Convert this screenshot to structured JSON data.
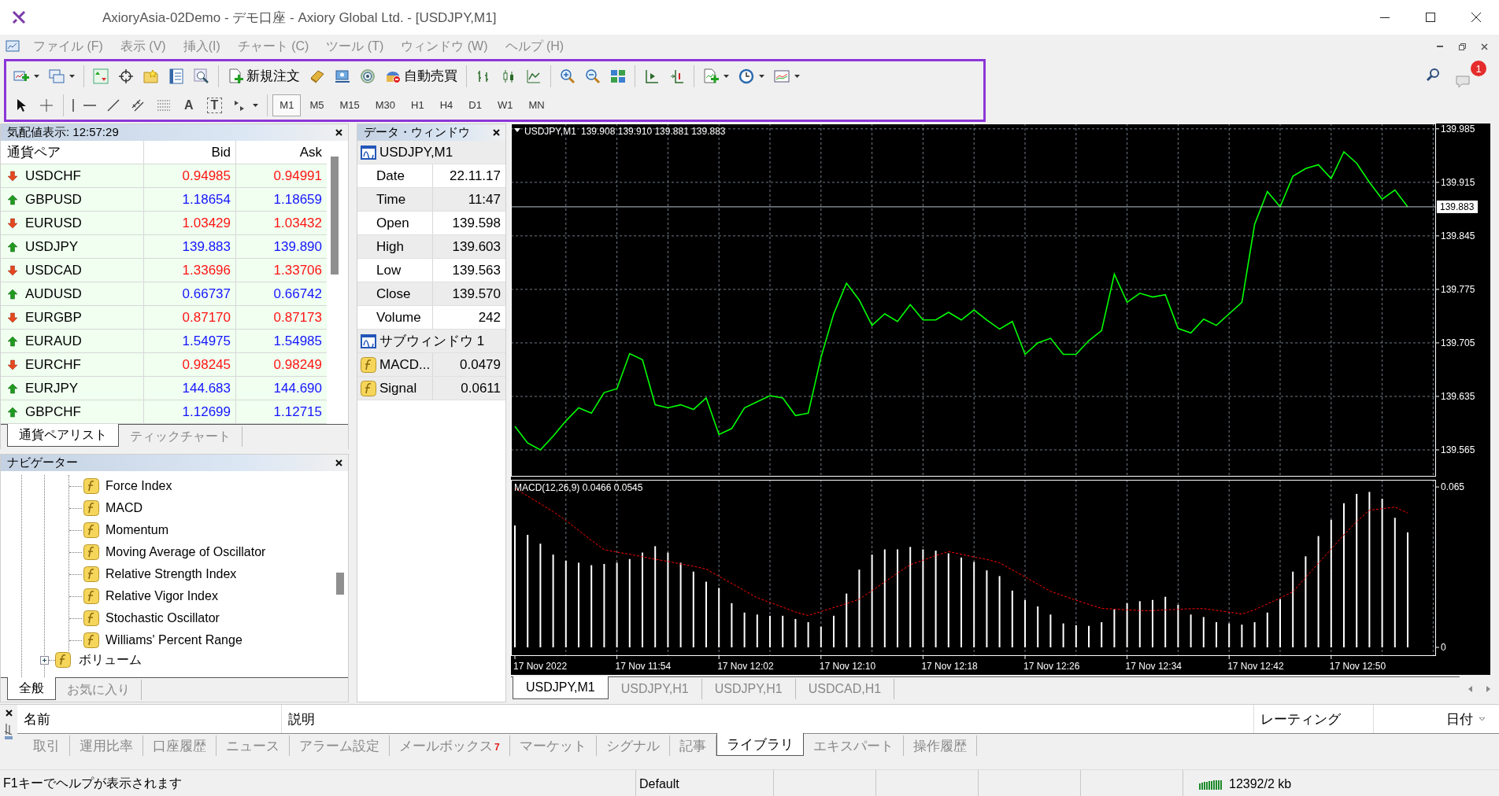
{
  "window": {
    "title": "AxioryAsia-02Demo - デモ口座 - Axiory Global Ltd. - [USDJPY,M1]"
  },
  "menu": [
    "ファイル (F)",
    "表示 (V)",
    "挿入(I)",
    "チャート (C)",
    "ツール (T)",
    "ウィンドウ (W)",
    "ヘルプ (H)"
  ],
  "toolbar": {
    "rows": [
      [
        {
          "kind": "icon",
          "dropdown": true
        },
        {
          "kind": "icon",
          "dropdown": true
        },
        {
          "kind": "separator"
        },
        {
          "kind": "icon",
          "dropdown": false
        },
        {
          "kind": "icon",
          "dropdown": false
        },
        {
          "kind": "icon",
          "dropdown": false
        },
        {
          "kind": "icon",
          "dropdown": false
        },
        {
          "kind": "icon",
          "dropdown": false
        },
        {
          "kind": "separator"
        },
        {
          "kind": "text",
          "label": "新規注文",
          "dropdown": false
        },
        {
          "kind": "icon",
          "dropdown": false
        },
        {
          "kind": "icon",
          "dropdown": false
        },
        {
          "kind": "icon",
          "dropdown": false
        },
        {
          "kind": "text",
          "label": "自動売買",
          "dropdown": false
        },
        {
          "kind": "separator"
        },
        {
          "kind": "icon",
          "dropdown": false
        },
        {
          "kind": "icon",
          "dropdown": false
        },
        {
          "kind": "icon",
          "dropdown": false
        },
        {
          "kind": "separator"
        },
        {
          "kind": "icon",
          "dropdown": false
        },
        {
          "kind": "icon",
          "dropdown": false
        },
        {
          "kind": "icon",
          "dropdown": false
        },
        {
          "kind": "separator"
        },
        {
          "kind": "icon",
          "dropdown": false
        },
        {
          "kind": "icon",
          "dropdown": false
        },
        {
          "kind": "separator"
        },
        {
          "kind": "icon",
          "dropdown": true
        },
        {
          "kind": "icon",
          "dropdown": true
        },
        {
          "kind": "icon",
          "dropdown": true
        }
      ],
      [
        {
          "kind": "icon",
          "dropdown": false
        },
        {
          "kind": "icon",
          "dropdown": false
        },
        {
          "kind": "separator"
        },
        {
          "kind": "icon",
          "dropdown": false
        },
        {
          "kind": "icon",
          "dropdown": false
        },
        {
          "kind": "icon",
          "dropdown": false
        },
        {
          "kind": "icon",
          "dropdown": false
        },
        {
          "kind": "icon",
          "dropdown": false
        },
        {
          "kind": "glyph",
          "label": "A",
          "boxed": false
        },
        {
          "kind": "glyph",
          "label": "T",
          "boxed": true
        },
        {
          "kind": "icon",
          "dropdown": true
        }
      ]
    ]
  },
  "timeframes": [
    {
      "label": "M1",
      "selected": true
    },
    {
      "label": "M5",
      "selected": false
    },
    {
      "label": "M15",
      "selected": false
    },
    {
      "label": "M30",
      "selected": false
    },
    {
      "label": "H1",
      "selected": false
    },
    {
      "label": "H4",
      "selected": false
    },
    {
      "label": "D1",
      "selected": false
    },
    {
      "label": "W1",
      "selected": false
    },
    {
      "label": "MN",
      "selected": false
    }
  ],
  "notifications": {
    "count": "1"
  },
  "market_watch": {
    "title": "気配値表示: 12:57:29",
    "columns": [
      "通貨ペア",
      "Bid",
      "Ask"
    ],
    "rows": [
      {
        "symbol": "USDCHF",
        "bid": "0.94985",
        "ask": "0.94991",
        "rising": false
      },
      {
        "symbol": "GBPUSD",
        "bid": "1.18654",
        "ask": "1.18659",
        "rising": true
      },
      {
        "symbol": "EURUSD",
        "bid": "1.03429",
        "ask": "1.03432",
        "rising": false
      },
      {
        "symbol": "USDJPY",
        "bid": "139.883",
        "ask": "139.890",
        "rising": true
      },
      {
        "symbol": "USDCAD",
        "bid": "1.33696",
        "ask": "1.33706",
        "rising": false
      },
      {
        "symbol": "AUDUSD",
        "bid": "0.66737",
        "ask": "0.66742",
        "rising": true
      },
      {
        "symbol": "EURGBP",
        "bid": "0.87170",
        "ask": "0.87173",
        "rising": false
      },
      {
        "symbol": "EURAUD",
        "bid": "1.54975",
        "ask": "1.54985",
        "rising": true
      },
      {
        "symbol": "EURCHF",
        "bid": "0.98245",
        "ask": "0.98249",
        "rising": false
      },
      {
        "symbol": "EURJPY",
        "bid": "144.683",
        "ask": "144.690",
        "rising": true
      },
      {
        "symbol": "GBPCHF",
        "bid": "1.12699",
        "ask": "1.12715",
        "rising": true
      }
    ],
    "tabs": [
      {
        "label": "通貨ペアリスト",
        "selected": true
      },
      {
        "label": "ティックチャート",
        "selected": false
      }
    ]
  },
  "data_window": {
    "title": "データ・ウィンドウ",
    "rows": [
      {
        "kind": "header",
        "label": "USDJPY,M1"
      },
      {
        "kind": "field",
        "label": "Date",
        "value": "22.11.17"
      },
      {
        "kind": "field",
        "label": "Time",
        "value": "11:47"
      },
      {
        "kind": "field",
        "label": "Open",
        "value": "139.598"
      },
      {
        "kind": "field",
        "label": "High",
        "value": "139.603"
      },
      {
        "kind": "field",
        "label": "Low",
        "value": "139.563"
      },
      {
        "kind": "field",
        "label": "Close",
        "value": "139.570"
      },
      {
        "kind": "field",
        "label": "Volume",
        "value": "242"
      },
      {
        "kind": "header",
        "label": "サブウィンドウ 1"
      },
      {
        "kind": "indicator",
        "label": "MACD...",
        "value": "0.0479"
      },
      {
        "kind": "indicator",
        "label": "Signal",
        "value": "0.0611"
      }
    ]
  },
  "navigator": {
    "title": "ナビゲーター",
    "items": [
      {
        "children": [
          {
            "label": "Force Index"
          },
          {
            "label": "MACD"
          },
          {
            "label": "Momentum"
          },
          {
            "label": "Moving Average of Oscillator"
          },
          {
            "label": "Relative Strength Index"
          },
          {
            "label": "Relative Vigor Index"
          },
          {
            "label": "Stochastic Oscillator"
          },
          {
            "label": "Williams' Percent Range"
          }
        ]
      },
      {
        "label": "ボリューム",
        "expanded": false
      }
    ],
    "tabs": [
      {
        "label": "全般",
        "selected": true
      },
      {
        "label": "お気に入り",
        "selected": false
      }
    ]
  },
  "chart": {
    "legend": "139.908 139.910 139.881 139.883",
    "chart_data": {
      "type": "line",
      "title": "USDJPY,M1",
      "grid": true,
      "ylim": [
        139.53,
        139.992
      ],
      "ref_lines": [
        {
          "axis": "y",
          "value": 139.883,
          "label": "139.883"
        }
      ],
      "yticks": [
        139.565,
        139.635,
        139.705,
        139.775,
        139.845,
        139.915,
        139.985
      ],
      "series": [
        {
          "color": "#00ff00",
          "values": [
            139.596,
            139.574,
            139.565,
            139.583,
            139.603,
            139.62,
            139.613,
            139.64,
            139.645,
            139.691,
            139.683,
            139.624,
            139.62,
            139.624,
            139.618,
            139.633,
            139.585,
            139.593,
            139.62,
            139.628,
            139.636,
            139.633,
            139.61,
            139.613,
            139.686,
            139.743,
            139.783,
            139.761,
            139.728,
            139.743,
            139.733,
            139.755,
            139.735,
            139.735,
            139.745,
            139.735,
            139.748,
            139.735,
            139.723,
            139.733,
            139.69,
            139.705,
            139.711,
            139.69,
            139.69,
            139.708,
            139.721,
            139.795,
            139.758,
            139.77,
            139.765,
            139.768,
            139.724,
            139.718,
            139.736,
            139.728,
            139.743,
            139.758,
            139.86,
            139.903,
            139.883,
            139.923,
            139.933,
            139.938,
            139.92,
            139.955,
            139.94,
            139.915,
            139.893,
            139.905,
            139.883
          ]
        }
      ]
    },
    "subwindow": {
      "legend": "MACD(12,26,9) 0.0466 0.0545",
      "time_axis": [
        "17 Nov 2022",
        "17 Nov 11:54",
        "17 Nov 12:02",
        "17 Nov 12:10",
        "17 Nov 12:18",
        "17 Nov 12:26",
        "17 Nov 12:34",
        "17 Nov 12:42",
        "17 Nov 12:50"
      ],
      "chart_data": {
        "type": "bar",
        "grid": true,
        "ylim": [
          -0.0035,
          0.0679
        ],
        "yticks": [
          0,
          0.065
        ],
        "series": [
          {
            "color": "#ffffff",
            "values": [
              0.0494,
              0.0456,
              0.042,
              0.0376,
              0.0351,
              0.0343,
              0.0333,
              0.0338,
              0.0343,
              0.0358,
              0.0384,
              0.041,
              0.0384,
              0.0343,
              0.0307,
              0.0266,
              0.0241,
              0.0179,
              0.0141,
              0.0133,
              0.0128,
              0.0128,
              0.0115,
              0.0102,
              0.0084,
              0.0128,
              0.0218,
              0.0315,
              0.0376,
              0.0397,
              0.0397,
              0.0407,
              0.0397,
              0.0392,
              0.0381,
              0.0364,
              0.0346,
              0.0312,
              0.0289,
              0.023,
              0.0192,
              0.0166,
              0.0133,
              0.0097,
              0.009,
              0.0087,
              0.0102,
              0.0154,
              0.0179,
              0.0187,
              0.0192,
              0.0205,
              0.0172,
              0.0133,
              0.0123,
              0.0102,
              0.0097,
              0.0092,
              0.0102,
              0.0141,
              0.0195,
              0.0307,
              0.0369,
              0.0451,
              0.0517,
              0.0584,
              0.0622,
              0.063,
              0.0602,
              0.0525,
              0.0466
            ]
          },
          {
            "color": "#ff0000",
            "type": "line",
            "line_style": "dashed",
            "values": [
              0.0645,
              0.0613,
              0.0582,
              0.055,
              0.0514,
              0.0474,
              0.0434,
              0.0396,
              0.0386,
              0.0377,
              0.0367,
              0.0357,
              0.0348,
              0.0338,
              0.0329,
              0.0317,
              0.0288,
              0.0259,
              0.023,
              0.0201,
              0.0182,
              0.0163,
              0.0143,
              0.0129,
              0.0145,
              0.0161,
              0.0177,
              0.0195,
              0.023,
              0.0265,
              0.0301,
              0.0335,
              0.0353,
              0.0372,
              0.0388,
              0.0377,
              0.0366,
              0.0356,
              0.0343,
              0.0314,
              0.0285,
              0.0256,
              0.0227,
              0.0209,
              0.0191,
              0.0174,
              0.0158,
              0.0155,
              0.0152,
              0.0149,
              0.0149,
              0.0152,
              0.0154,
              0.0157,
              0.0157,
              0.015,
              0.0143,
              0.0135,
              0.0152,
              0.0176,
              0.02,
              0.0225,
              0.0283,
              0.0341,
              0.0398,
              0.0456,
              0.051,
              0.0556,
              0.0562,
              0.0568,
              0.0545
            ]
          }
        ]
      }
    },
    "tabs": [
      {
        "label": "USDJPY,M1",
        "selected": true
      },
      {
        "label": "USDJPY,H1",
        "selected": false
      },
      {
        "label": "USDJPY,H1",
        "selected": false
      },
      {
        "label": "USDCAD,H1",
        "selected": false
      }
    ]
  },
  "terminal": {
    "columns": [
      "名前",
      "説明",
      "レーティング",
      "日付"
    ],
    "tabs": [
      {
        "label": "取引",
        "selected": false
      },
      {
        "label": "運用比率",
        "selected": false
      },
      {
        "label": "口座履歴",
        "selected": false
      },
      {
        "label": "ニュース",
        "selected": false
      },
      {
        "label": "アラーム設定",
        "selected": false
      },
      {
        "label": "メールボックス",
        "badge": "7",
        "selected": false
      },
      {
        "label": "マーケット",
        "selected": false
      },
      {
        "label": "シグナル",
        "selected": false
      },
      {
        "label": "記事",
        "selected": false
      },
      {
        "label": "ライブラリ",
        "selected": true
      },
      {
        "label": "エキスパート",
        "selected": false
      },
      {
        "label": "操作履歴",
        "selected": false
      }
    ]
  },
  "status_bar": {
    "cells": [
      "F1キーでヘルプが表示されます",
      "Default"
    ],
    "memory": "12392/2 kb"
  }
}
